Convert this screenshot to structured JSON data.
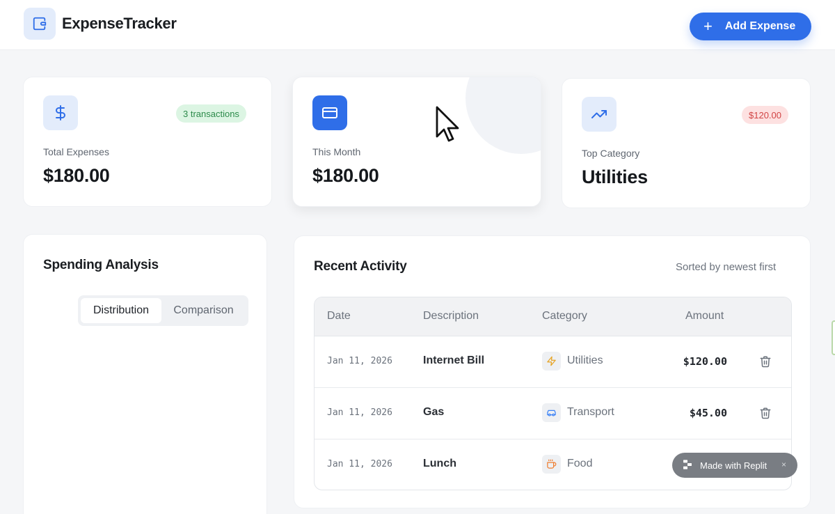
{
  "header": {
    "app_title": "ExpenseTracker",
    "logo_icon": "wallet-icon",
    "add_button_label": "Add Expense"
  },
  "stats": [
    {
      "label": "Total Expenses",
      "value": "$180.00",
      "badge": "3 transactions",
      "icon": "dollar-icon",
      "badge_color": "#2c8a4a"
    },
    {
      "label": "This Month",
      "value": "$180.00",
      "icon": "credit-card-icon"
    },
    {
      "label": "Top Category",
      "value": "Utilities",
      "badge": "$120.00",
      "icon": "trending-up-icon",
      "badge_color": "#d14444"
    }
  ],
  "analysis": {
    "title": "Spending Analysis",
    "tabs": [
      {
        "label": "Distribution",
        "active": true
      },
      {
        "label": "Comparison",
        "active": false
      }
    ]
  },
  "activity": {
    "title": "Recent Activity",
    "sort_note": "Sorted by newest first",
    "columns": [
      "Date",
      "Description",
      "Category",
      "Amount"
    ],
    "rows": [
      {
        "date": "Jan 11, 2026",
        "description": "Internet Bill",
        "category": "Utilities",
        "category_icon": "zap-icon",
        "amount": "$120.00"
      },
      {
        "date": "Jan 11, 2026",
        "description": "Gas",
        "category": "Transport",
        "category_icon": "car-icon",
        "amount": "$45.00"
      },
      {
        "date": "Jan 11, 2026",
        "description": "Lunch",
        "category": "Food",
        "category_icon": "coffee-icon",
        "amount": ""
      }
    ]
  },
  "replit_badge": {
    "label": "Made with Replit",
    "close": "×"
  },
  "colors": {
    "accent": "#2f6ee8",
    "background": "#f5f6f8"
  }
}
